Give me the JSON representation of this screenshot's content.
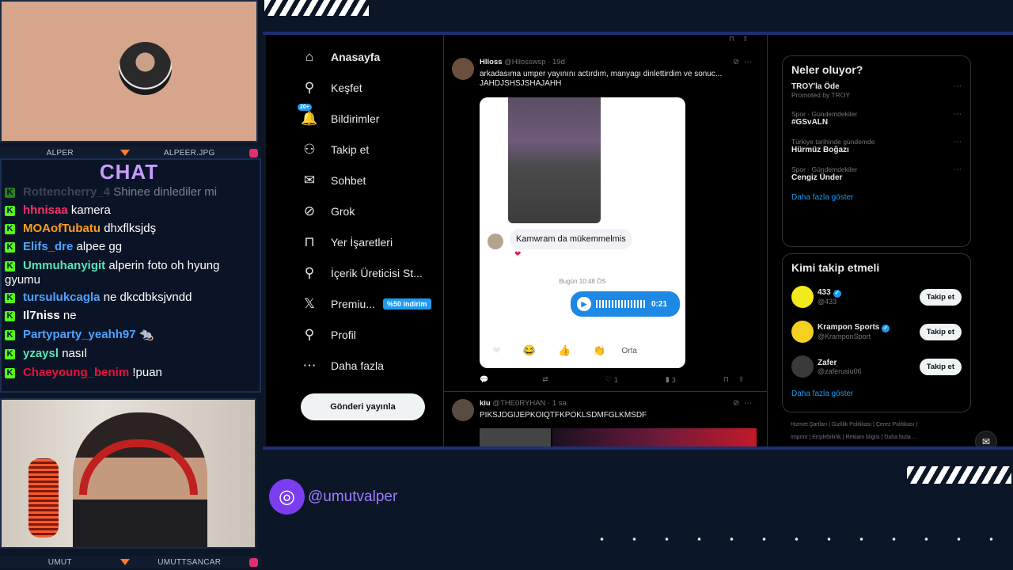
{
  "overlay": {
    "top_cam": {
      "name_left": "ALPER",
      "name_right": "ALPEER.JPG"
    },
    "bottom_cam": {
      "name_left": "UMUT",
      "name_right": "UMUTTSANCAR"
    },
    "chat_title": "CHAT",
    "chat": [
      {
        "user": "Rottencherry_4",
        "color": "#777f8a",
        "msg": "Shinee dinlediler mi",
        "faded": true
      },
      {
        "user": "hhnisaa",
        "color": "#ff2e6a",
        "msg": "kamera"
      },
      {
        "user": "MOAofTubatu",
        "color": "#ff9d1e",
        "msg": "dhxflksjdş"
      },
      {
        "user": "Elifs_dre",
        "color": "#4fa3ff",
        "msg": "alpee gg"
      },
      {
        "user": "Ummuhanyigit",
        "color": "#58e6b5",
        "msg": "alperin foto oh hyung gyumu"
      },
      {
        "user": "tursulukcagla",
        "color": "#4fa3ff",
        "msg": "ne dkcdbksjvndd"
      },
      {
        "user": "Il7niss",
        "color": "#ffffff",
        "msg": "ne"
      },
      {
        "user": "Partyparty_yeahh97",
        "color": "#4fa3ff",
        "msg": "🐀"
      },
      {
        "user": "yzaysl",
        "color": "#58e6b5",
        "msg": "nasıl"
      },
      {
        "user": "Chaeyoung_benim",
        "color": "#e8123c",
        "msg": "!puan"
      }
    ],
    "social_handle": "@umutvalper"
  },
  "nav": {
    "items": [
      {
        "label": "Anasayfa",
        "icon": "home-icon",
        "glyph": "⌂"
      },
      {
        "label": "Keşfet",
        "icon": "search-icon",
        "glyph": "⚲"
      },
      {
        "label": "Bildirimler",
        "icon": "bell-icon",
        "glyph": "🔔"
      },
      {
        "label": "Takip et",
        "icon": "follow-icon",
        "glyph": "⚇"
      },
      {
        "label": "Sohbet",
        "icon": "mail-icon",
        "glyph": "✉"
      },
      {
        "label": "Grok",
        "icon": "grok-icon",
        "glyph": "⊘"
      },
      {
        "label": "Yer İşaretleri",
        "icon": "bookmark-icon",
        "glyph": "⊓"
      },
      {
        "label": "İçerik Üreticisi St...",
        "icon": "creator-icon",
        "glyph": "⚲"
      },
      {
        "label": "Premiu...",
        "icon": "x-logo-icon",
        "glyph": "𝕏"
      },
      {
        "label": "Profil",
        "icon": "profile-icon",
        "glyph": "⚲"
      },
      {
        "label": "Daha fazla",
        "icon": "more-icon",
        "glyph": "⋯"
      }
    ],
    "notif_badge": "20+",
    "premium_promo": "%50 indirim",
    "post_button": "Gönderi yayınla"
  },
  "feed": {
    "tweet1": {
      "name": "Hlloss",
      "handle": "@Hllosswsp",
      "time": "19d",
      "text_line1": "arkadasıma umper yayınını actırdım, manyagı dinlettirdim ve sonuc...",
      "text_line2": "JAHDJSHSJSHAJAHH",
      "media": {
        "incoming_message": "Kamwram da mükemmelmis",
        "timestamp": "Bugün 10:48 ÖS",
        "audio_duration": "0:21",
        "reactions": [
          "❤",
          "😂",
          "👍",
          "👏"
        ],
        "orta_label": "Orta"
      },
      "likes": "1",
      "views": "3"
    },
    "tweet2": {
      "name": "kiu",
      "handle": "@THE0RYHAN",
      "time": "1 sa",
      "text": "PIKSJDGIJEPKOIQTFKPOKLSDMFGLKMSDF"
    }
  },
  "trends": {
    "title": "Neler oluyor?",
    "items": [
      {
        "category": "Promoted by TROY",
        "name": "TROY'la Öde",
        "promoted": true
      },
      {
        "category": "Spor · Gündemdekiler",
        "name": "#GSvALN"
      },
      {
        "category": "Türkiye tarihinde gündemde",
        "name": "Hürmüz Boğazı"
      },
      {
        "category": "Spor · Gündemdekiler",
        "name": "Cengiz Ünder"
      }
    ],
    "show_more": "Daha fazla göster"
  },
  "who_to_follow": {
    "title": "Kimi takip etmeli",
    "accounts": [
      {
        "name": "433",
        "handle": "@433",
        "verified": true,
        "avatar_color": "#f2ea1c"
      },
      {
        "name": "Krampon Sports",
        "handle": "@KramponSport",
        "verified": true,
        "avatar_color": "#f5d020"
      },
      {
        "name": "Zafer",
        "handle": "@zaferusiu06",
        "verified": false,
        "avatar_color": "#3a3a3a"
      }
    ],
    "follow_label": "Takip et",
    "show_more": "Daha fazla göster"
  },
  "footer": {
    "row1": "Hizmet Şartları  |  Gizlilik Politikası  |  Çerez Politikası  |",
    "row2": "Imprint  |  Erişilebilirlik  |  Reklam bilgisi  |  Daha fazla ..."
  }
}
